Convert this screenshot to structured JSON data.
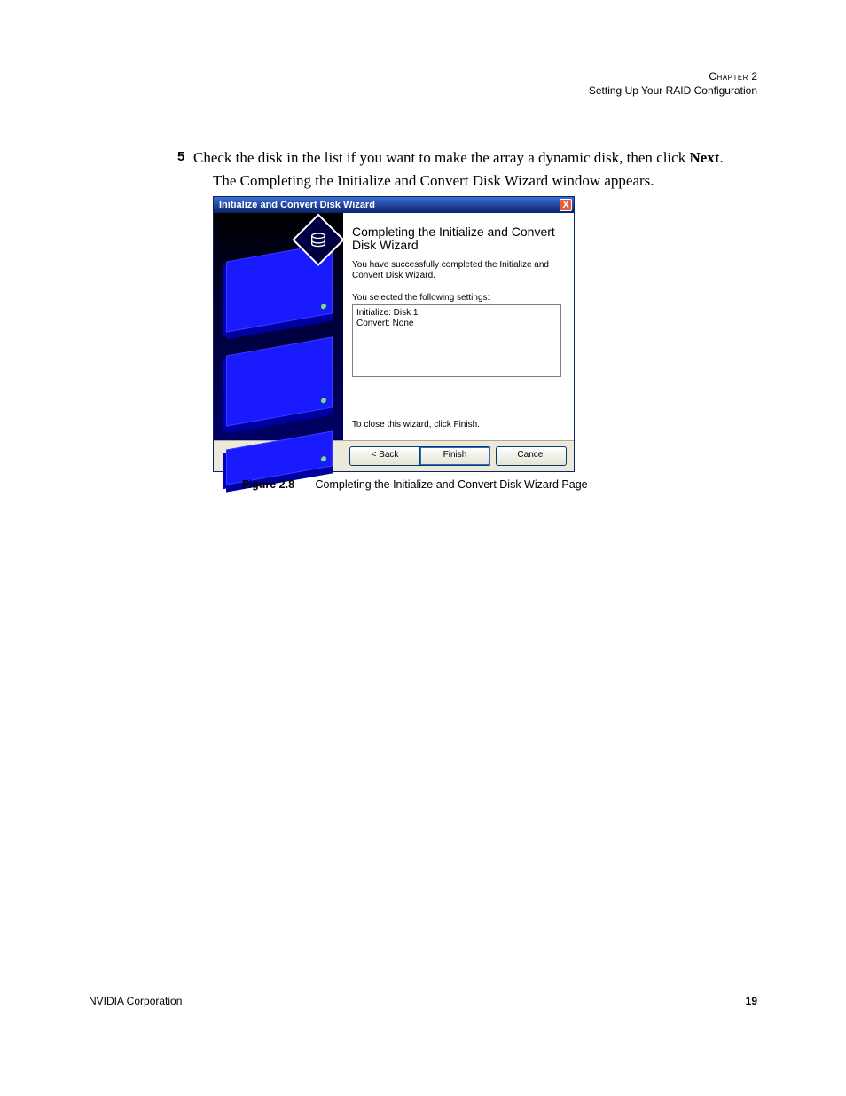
{
  "header": {
    "chapter_label": "Chapter",
    "chapter_number": "2",
    "subtitle": "Setting Up Your RAID Configuration"
  },
  "step": {
    "number": "5",
    "text_before_bold": "Check the disk in the list if you want to make the array a dynamic disk, then click ",
    "bold_word": "Next",
    "text_after_bold": ".",
    "subtext": "The Completing the Initialize and Convert Disk Wizard window appears."
  },
  "wizard": {
    "title": "Initialize and Convert Disk Wizard",
    "close_x": "X",
    "heading": "Completing the Initialize and Convert Disk Wizard",
    "para1": "You have successfully completed the Initialize and Convert Disk Wizard.",
    "settings_label": "You selected the following settings:",
    "settings_line1": "Initialize: Disk 1",
    "settings_line2": "Convert: None",
    "close_text": "To close this wizard, click Finish.",
    "buttons": {
      "back": "< Back",
      "finish": "Finish",
      "cancel": "Cancel"
    }
  },
  "caption": {
    "label": "Figure 2.8",
    "text": "Completing the Initialize and Convert Disk Wizard Page"
  },
  "footer": {
    "company": "NVIDIA Corporation",
    "page": "19"
  }
}
